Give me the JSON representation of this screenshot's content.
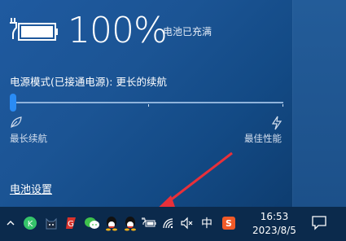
{
  "battery": {
    "percent": "100%",
    "status": "电池已充满"
  },
  "power_mode": {
    "label": "电源模式(已接通电源): 更长的续航",
    "slider_value_fraction": 0.0,
    "left_label": "最长续航",
    "right_label": "最佳性能"
  },
  "settings_link": "电池设置",
  "taskbar": {
    "time": "16:53",
    "date": "2023/8/5",
    "ime_label": "中",
    "tray_icons": [
      "expand-icon",
      "kaspersky-icon",
      "cat-icon",
      "gtalk-icon",
      "wechat-icon",
      "qq-icon",
      "qq-icon",
      "battery-icon",
      "wifi-icon",
      "mute-icon",
      "ime-icon",
      "sogou-icon"
    ]
  },
  "colors": {
    "flyout_bg": "#1b5494",
    "taskbar_bg": "#0b2a4c",
    "slider_thumb": "#2a8cf5",
    "annotation_arrow": "#e8303a"
  }
}
